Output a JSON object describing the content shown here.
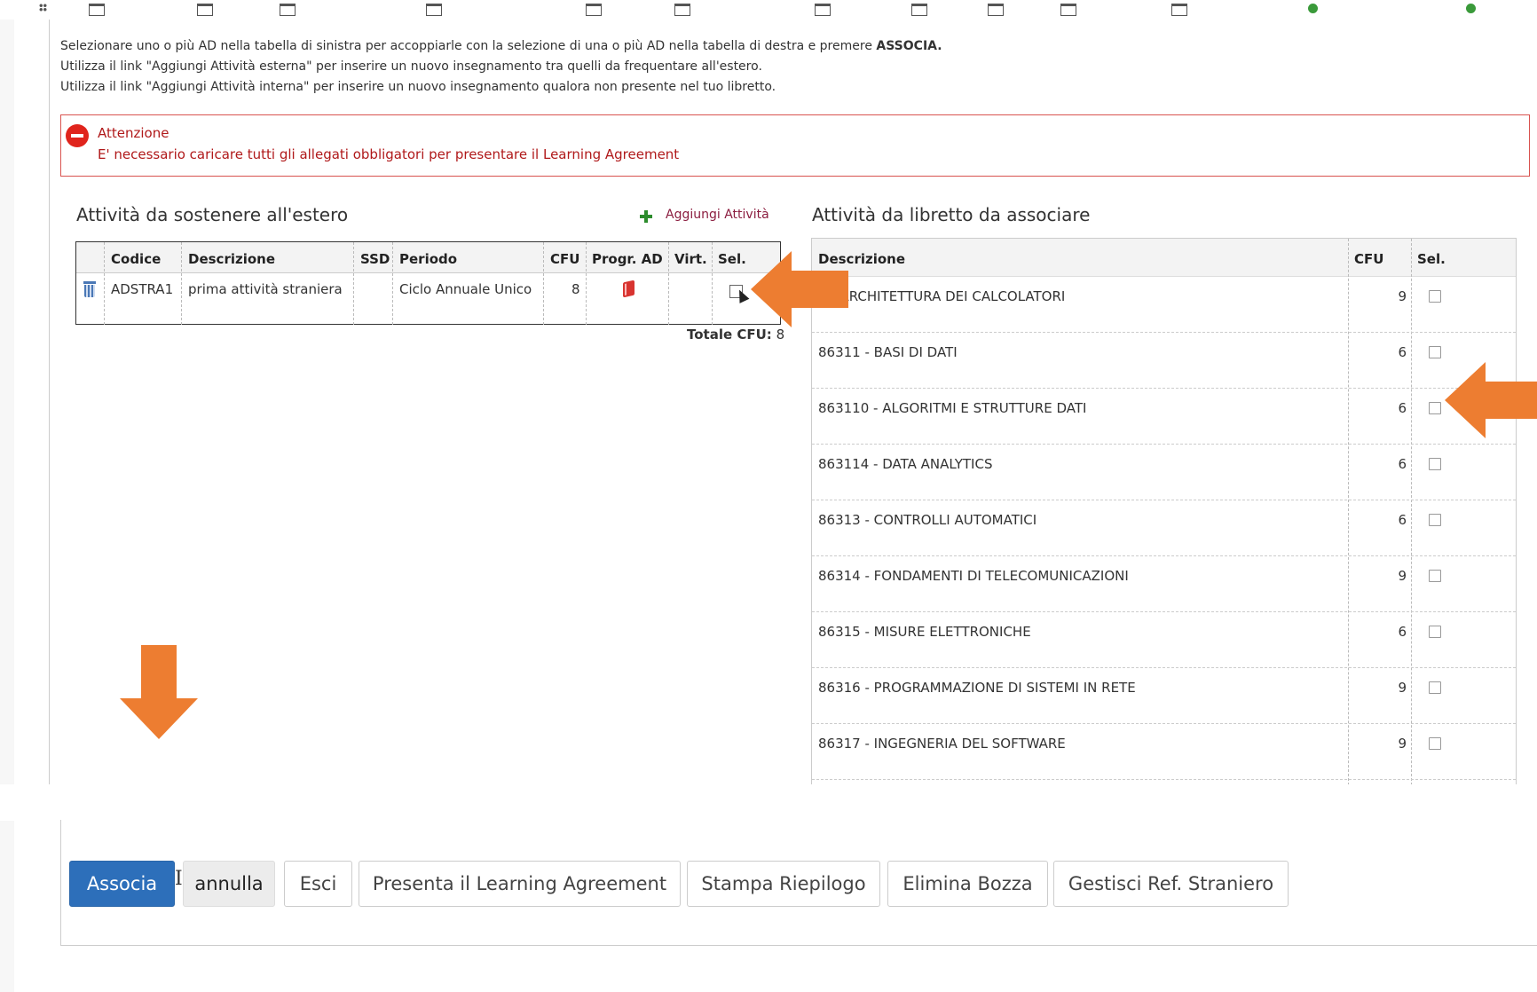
{
  "instructions": {
    "line1_pre": "Selezionare uno o più AD nella tabella di sinistra per accoppiarle con la selezione di una o più AD nella tabella di destra e premere ",
    "line1_bold": "ASSOCIA.",
    "line2": "Utilizza il link \"Aggiungi Attività esterna\" per inserire un nuovo insegnamento tra quelli da frequentare all'estero.",
    "line3": "Utilizza il link \"Aggiungi Attività interna\" per inserire un nuovo insegnamento qualora non presente nel tuo libretto."
  },
  "alert": {
    "title": "Attenzione",
    "message": "E' necessario caricare tutti gli allegati obbligatori per presentare il Learning Agreement",
    "color": "#b0191a"
  },
  "left_section": {
    "title": "Attività da sostenere all'estero",
    "add_link": "Aggiungi Attività",
    "headers": [
      "Codice",
      "Descrizione",
      "SSD",
      "Periodo",
      "CFU",
      "Progr. AD",
      "Virt.",
      "Sel."
    ],
    "row": {
      "codice": "ADSTRA1",
      "descrizione": "prima attività straniera",
      "ssd": "",
      "periodo": "Ciclo Annuale Unico",
      "cfu": "8",
      "progr_icon": "book-icon",
      "virt": "",
      "sel_icon": "select-icon"
    },
    "total_label": "Totale CFU:",
    "total_value": "8"
  },
  "right_section": {
    "title": "Attività da libretto da associare",
    "headers": [
      "Descrizione",
      "CFU",
      "Sel."
    ],
    "rows": [
      {
        "descrizione": "0 - ARCHITETTURA DEI CALCOLATORI",
        "cfu": "9"
      },
      {
        "descrizione": "86311 - BASI DI DATI",
        "cfu": "6"
      },
      {
        "descrizione": "863110 - ALGORITMI E STRUTTURE DATI",
        "cfu": "6"
      },
      {
        "descrizione": "863114 - DATA ANALYTICS",
        "cfu": "6"
      },
      {
        "descrizione": "86313 - CONTROLLI AUTOMATICI",
        "cfu": "6"
      },
      {
        "descrizione": "86314 - FONDAMENTI DI TELECOMUNICAZIONI",
        "cfu": "9"
      },
      {
        "descrizione": "86315 - MISURE ELETTRONICHE",
        "cfu": "6"
      },
      {
        "descrizione": "86316 - PROGRAMMAZIONE DI SISTEMI IN RETE",
        "cfu": "9"
      },
      {
        "descrizione": "86317 - INGEGNERIA DEL SOFTWARE",
        "cfu": "9"
      }
    ]
  },
  "buttons": {
    "associa": "Associa",
    "annulla": "annulla",
    "esci": "Esci",
    "presenta": "Presenta il Learning Agreement",
    "stampa": "Stampa Riepilogo",
    "elimina": "Elimina Bozza",
    "gestisci": "Gestisci Ref. Straniero"
  },
  "annotation_arrow_color": "#ed7d31",
  "primary_color": "#2d6fba"
}
